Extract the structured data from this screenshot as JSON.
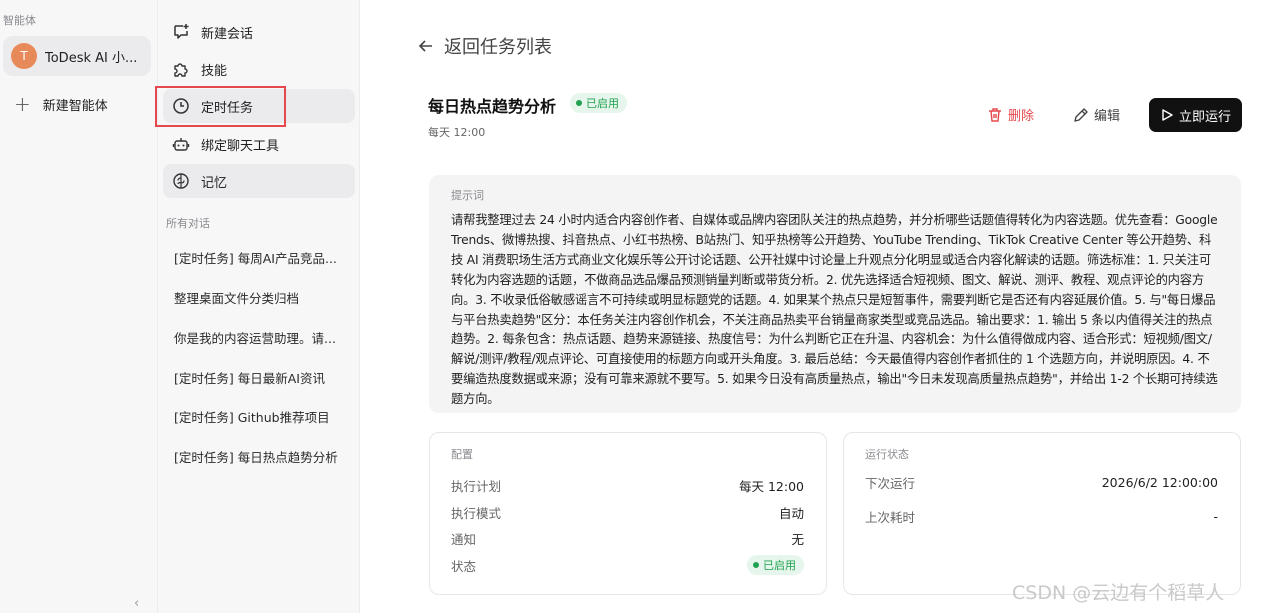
{
  "sidebar": {
    "section_title": "智能体",
    "agent": {
      "avatar_letter": "T",
      "name": "ToDesk AI 小...",
      "avatar_color": "#e8895a"
    },
    "new_agent_label": "新建智能体",
    "collapse_glyph": "‹"
  },
  "nav": {
    "items": [
      {
        "label": "新建会话",
        "icon": "chat-plus-icon"
      },
      {
        "label": "技能",
        "icon": "puzzle-icon"
      },
      {
        "label": "定时任务",
        "icon": "clock-icon"
      },
      {
        "label": "绑定聊天工具",
        "icon": "bot-icon"
      },
      {
        "label": "记忆",
        "icon": "brain-icon"
      }
    ],
    "conversations_label": "所有对话",
    "conversations": [
      "[定时任务] 每周AI产品竞品...",
      "整理桌面文件分类归档",
      "你是我的内容运营助理。请...",
      "[定时任务] 每日最新AI资讯",
      "[定时任务] Github推荐项目",
      "[定时任务] 每日热点趋势分析"
    ]
  },
  "main": {
    "back_label": "返回任务列表",
    "task": {
      "title": "每日热点趋势分析",
      "status": "已启用",
      "schedule": "每天 12:00"
    },
    "actions": {
      "delete": "删除",
      "edit": "编辑",
      "run": "立即运行"
    },
    "prompt": {
      "label": "提示词",
      "text": "请帮我整理过去 24 小时内适合内容创作者、自媒体或品牌内容团队关注的热点趋势，并分析哪些话题值得转化为内容选题。优先查看：Google Trends、微博热搜、抖音热点、小红书热榜、B站热门、知乎热榜等公开趋势、YouTube Trending、TikTok Creative Center 等公开趋势、科技 AI 消费职场生活方式商业文化娱乐等公开讨论话题、公开社媒中讨论量上升观点分化明显或适合内容化解读的话题。筛选标准：1. 只关注可转化为内容选题的话题，不做商品选品爆品预测销量判断或带货分析。2. 优先选择适合短视频、图文、解说、测评、教程、观点评论的内容方向。3. 不收录低俗敏感谣言不可持续或明显标题党的话题。4. 如果某个热点只是短暂事件，需要判断它是否还有内容延展价值。5. 与\"每日爆品与平台热卖趋势\"区分：本任务关注内容创作机会，不关注商品热卖平台销量商家类型或竞品选品。输出要求：1. 输出 5 条以内值得关注的热点趋势。2. 每条包含：热点话题、趋势来源链接、热度信号：为什么判断它正在升温、内容机会：为什么值得做成内容、适合形式：短视频/图文/解说/测评/教程/观点评论、可直接使用的标题方向或开头角度。3. 最后总结：今天最值得内容创作者抓住的 1 个选题方向，并说明原因。4. 不要编造热度数据或来源；没有可靠来源就不要写。5. 如果今日没有高质量热点，输出\"今日未发现高质量热点趋势\"，并给出 1-2 个长期可持续选题方向。"
    },
    "config": {
      "title": "配置",
      "rows": [
        {
          "key": "执行计划",
          "value": "每天 12:00"
        },
        {
          "key": "执行模式",
          "value": "自动"
        },
        {
          "key": "通知",
          "value": "无"
        },
        {
          "key": "状态",
          "value": "已启用"
        }
      ]
    },
    "run_status": {
      "title": "运行状态",
      "rows": [
        {
          "key": "下次运行",
          "value": "2026/6/2 12:00:00"
        },
        {
          "key": "上次耗时",
          "value": "-"
        }
      ]
    }
  },
  "watermark": "CSDN @云边有个稻草人",
  "colors": {
    "accent_red": "#e5484d",
    "success_green": "#20a150",
    "run_button": "#111111"
  }
}
